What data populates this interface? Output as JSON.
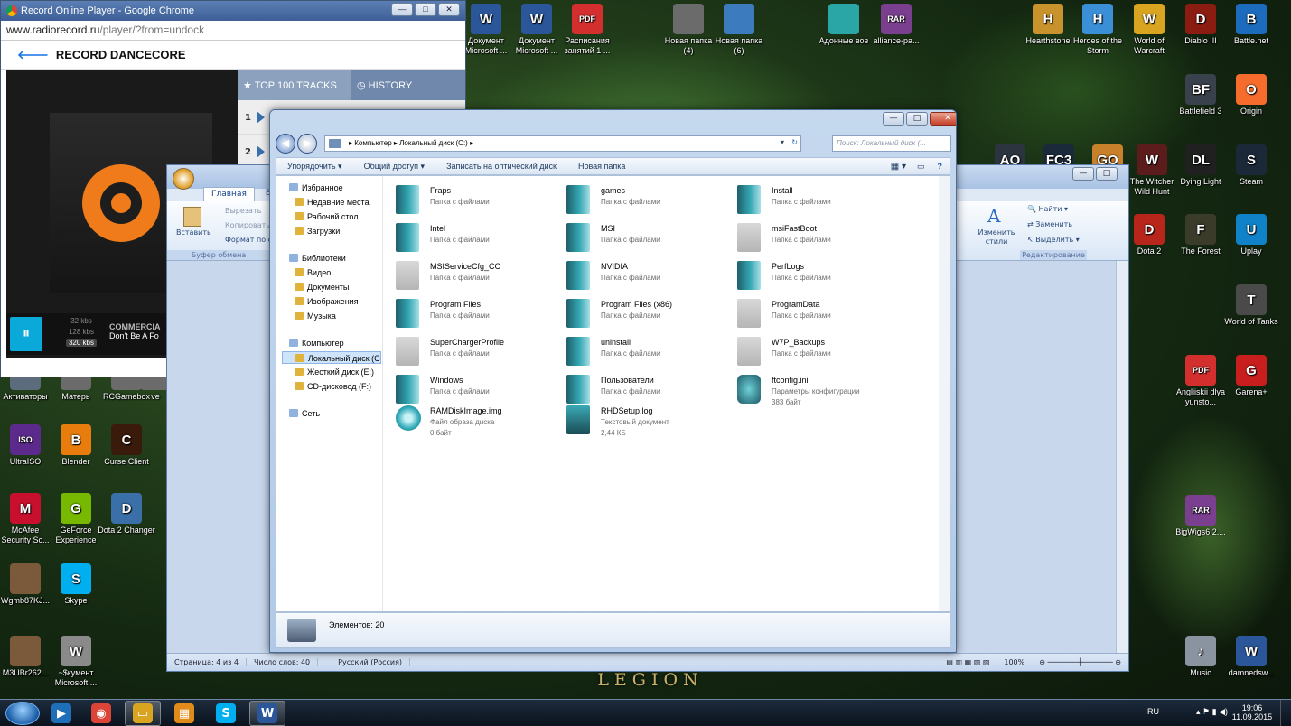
{
  "desktop": {
    "wallpaper_text": "LEGION",
    "icons_top": [
      {
        "label": "Документ Microsoft ...",
        "color": "#2b579a",
        "glyph": "W"
      },
      {
        "label": "Документ Microsoft ...",
        "color": "#2b579a",
        "glyph": "W"
      },
      {
        "label": "Расписания занятий 1 ...",
        "color": "#d32f2f",
        "glyph": "PDF"
      },
      {
        "label": "Новая папка (4)",
        "color": "#6b6b6b",
        "glyph": ""
      },
      {
        "label": "Новая папка (6)",
        "color": "#3d7bbf",
        "glyph": ""
      },
      {
        "label": "Адонные вов",
        "color": "#2aa6a6",
        "glyph": ""
      },
      {
        "label": "alliance-pa...",
        "color": "#7a3f8f",
        "glyph": "RAR"
      }
    ],
    "icons_games_top": [
      {
        "label": "Hearthstone",
        "color": "#c8932c",
        "glyph": "H"
      },
      {
        "label": "Heroes of the Storm",
        "color": "#3a8fd6",
        "glyph": "H"
      },
      {
        "label": "World of Warcraft",
        "color": "#d9a520",
        "glyph": "W"
      },
      {
        "label": "Diablo III",
        "color": "#8a1c12",
        "glyph": "D"
      },
      {
        "label": "Battle.net",
        "color": "#1c6bbd",
        "glyph": "B"
      }
    ],
    "icons_right": [
      {
        "label": "Battlefield 3",
        "color": "#39414c",
        "glyph": "BF"
      },
      {
        "label": "Origin",
        "color": "#f56c2d",
        "glyph": "O"
      },
      {
        "label": "The Witcher Wild Hunt",
        "color": "#5c1c1c",
        "glyph": "W"
      },
      {
        "label": "Dying Light",
        "color": "#202020",
        "glyph": "DL"
      },
      {
        "label": "Steam",
        "color": "#1b2838",
        "glyph": "S"
      },
      {
        "label": "Dota 2",
        "color": "#b8261b",
        "glyph": "D"
      },
      {
        "label": "The Forest",
        "color": "#3b3b2a",
        "glyph": "F"
      },
      {
        "label": "Uplay",
        "color": "#0f82c8",
        "glyph": "U"
      },
      {
        "label": "World of Tanks",
        "color": "#4a4a4a",
        "glyph": "T"
      },
      {
        "label": "Angliiskii dlya yunsto...",
        "color": "#d32f2f",
        "glyph": "PDF"
      },
      {
        "label": "Garena+",
        "color": "#c81e1e",
        "glyph": "G"
      },
      {
        "label": "BigWigs6.2....",
        "color": "#7a3f8f",
        "glyph": "RAR"
      },
      {
        "label": "Music",
        "color": "#8a94a0",
        "glyph": "♪"
      },
      {
        "label": "damnedsw...",
        "color": "#2b579a",
        "glyph": "W"
      }
    ],
    "icons_partial": [
      {
        "label": "AO",
        "color": "#2c3440"
      },
      {
        "label": "FC3",
        "color": "#1b2a3a"
      },
      {
        "label": "GO",
        "color": "#c9802a"
      }
    ],
    "icons_left": [
      {
        "label": "Активаторы",
        "color": "#5c6c7c",
        "glyph": ""
      },
      {
        "label": "Матерь",
        "color": "#6b6b6b",
        "glyph": ""
      },
      {
        "label": "RCGamebox",
        "color": "#6b6b6b",
        "glyph": ""
      },
      {
        "label": "ve",
        "color": "#6b6b6b",
        "glyph": ""
      },
      {
        "label": "UltraISO",
        "color": "#5b2a8c",
        "glyph": "ISO"
      },
      {
        "label": "Blender",
        "color": "#e87d0d",
        "glyph": "B"
      },
      {
        "label": "Curse Client",
        "color": "#3a1a0a",
        "glyph": "C"
      },
      {
        "label": "McAfee Security Sc...",
        "color": "#c8102e",
        "glyph": "M"
      },
      {
        "label": "GeForce Experience",
        "color": "#76b900",
        "glyph": "G"
      },
      {
        "label": "Dota 2 Changer",
        "color": "#3a6fa8",
        "glyph": "D"
      },
      {
        "label": "Wgmb87KJ...",
        "color": "#7a5a3a",
        "glyph": ""
      },
      {
        "label": "Skype",
        "color": "#00aff0",
        "glyph": "S"
      },
      {
        "label": "M3UBr262...",
        "color": "#7a5a3a",
        "glyph": ""
      },
      {
        "label": "~$кумент Microsoft ...",
        "color": "#8a8a8a",
        "glyph": "W"
      }
    ]
  },
  "chrome": {
    "title": "Record Online Player - Google Chrome",
    "url_host": "www.radiorecord.ru",
    "url_path": "/player/?from=undock",
    "station": "RECORD DANCECORE",
    "back_arrow": "🡐",
    "tab_top": "TOP 100 TRACKS",
    "tab_history": "HISTORY",
    "rows": [
      "1",
      "2"
    ],
    "bitrates": [
      "32 kbs",
      "128 kbs",
      "320 kbs"
    ],
    "track_artist": "COMMERCIA",
    "track_title": "Don't Be A Fo",
    "play_glyph": "⏸"
  },
  "word": {
    "tabs": [
      "Главная",
      "Вста"
    ],
    "paste": "Вставить",
    "cut": "Вырезать",
    "copy": "Копировать",
    "format": "Формат по о",
    "clipboard": "Буфер обмена",
    "styles": "Изменить стили",
    "find": "Найти",
    "replace": "Заменить",
    "select": "Выделить",
    "editing": "Редактирование",
    "status_page": "Страница: 4 из 4",
    "status_words": "Число слов: 40",
    "status_lang": "Русский (Россия)",
    "zoom": "100%"
  },
  "explorer": {
    "breadcrumb": [
      "Компьютер",
      "Локальный диск (C:)"
    ],
    "search_placeholder": "Поиск: Локальный диск (...",
    "commands": [
      "Упорядочить ▾",
      "Общий доступ ▾",
      "Записать на оптический диск",
      "Новая папка"
    ],
    "nav": [
      {
        "label": "Избранное",
        "header": true
      },
      {
        "label": "Недавние места"
      },
      {
        "label": "Рабочий стол"
      },
      {
        "label": "Загрузки"
      },
      {
        "label": "Библиотеки",
        "header": true
      },
      {
        "label": "Видео"
      },
      {
        "label": "Документы"
      },
      {
        "label": "Изображения"
      },
      {
        "label": "Музыка"
      },
      {
        "label": "Компьютер",
        "header": true
      },
      {
        "label": "Локальный диск (C:)",
        "selected": true
      },
      {
        "label": "Жесткий диск (E:)"
      },
      {
        "label": "CD-дисковод (F:)"
      },
      {
        "label": "Сеть",
        "header": true
      }
    ],
    "items": [
      {
        "name": "Fraps",
        "desc": "Папка с файлами",
        "kind": "folder"
      },
      {
        "name": "games",
        "desc": "Папка с файлами",
        "kind": "folder"
      },
      {
        "name": "Install",
        "desc": "Папка с файлами",
        "kind": "folder"
      },
      {
        "name": "Intel",
        "desc": "Папка с файлами",
        "kind": "folder"
      },
      {
        "name": "MSI",
        "desc": "Папка с файлами",
        "kind": "folder"
      },
      {
        "name": "msiFastBoot",
        "desc": "Папка с файлами",
        "kind": "folder-empty"
      },
      {
        "name": "MSIServiceCfg_CC",
        "desc": "Папка с файлами",
        "kind": "folder-empty"
      },
      {
        "name": "NVIDIA",
        "desc": "Папка с файлами",
        "kind": "folder"
      },
      {
        "name": "PerfLogs",
        "desc": "Папка с файлами",
        "kind": "folder"
      },
      {
        "name": "Program Files",
        "desc": "Папка с файлами",
        "kind": "folder"
      },
      {
        "name": "Program Files (x86)",
        "desc": "Папка с файлами",
        "kind": "folder"
      },
      {
        "name": "ProgramData",
        "desc": "Папка с файлами",
        "kind": "folder-empty"
      },
      {
        "name": "SuperChargerProfile",
        "desc": "Папка с файлами",
        "kind": "folder-empty"
      },
      {
        "name": "uninstall",
        "desc": "Папка с файлами",
        "kind": "folder"
      },
      {
        "name": "W7P_Backups",
        "desc": "Папка с файлами",
        "kind": "folder-empty"
      },
      {
        "name": "Windows",
        "desc": "Папка с файлами",
        "kind": "folder"
      },
      {
        "name": "Пользователи",
        "desc": "Папка с файлами",
        "kind": "folder"
      },
      {
        "name": "ftconfig.ini",
        "desc": "Параметры конфигурации",
        "size": "383 байт",
        "kind": "ini"
      },
      {
        "name": "RAMDiskImage.img",
        "desc": "Файл образа диска",
        "size": "0 байт",
        "kind": "img"
      },
      {
        "name": "RHDSetup.log",
        "desc": "Текстовый документ",
        "size": "2,44 КБ",
        "kind": "log"
      }
    ],
    "count": "Элементов: 20"
  },
  "taskbar": {
    "lang": "RU",
    "time": "19:06",
    "date": "11.09.2015",
    "apps": [
      {
        "name": "media-player",
        "color": "#1f6fb8",
        "glyph": "▶",
        "active": false
      },
      {
        "name": "chrome",
        "color": "#db4437",
        "glyph": "◉",
        "active": false
      },
      {
        "name": "explorer",
        "color": "#d9a520",
        "glyph": "▭",
        "active": true
      },
      {
        "name": "apps-grid",
        "color": "#e08a1a",
        "glyph": "▦",
        "active": false
      },
      {
        "name": "skype",
        "color": "#00aff0",
        "glyph": "S",
        "active": false
      },
      {
        "name": "word",
        "color": "#2b579a",
        "glyph": "W",
        "active": true
      }
    ]
  }
}
